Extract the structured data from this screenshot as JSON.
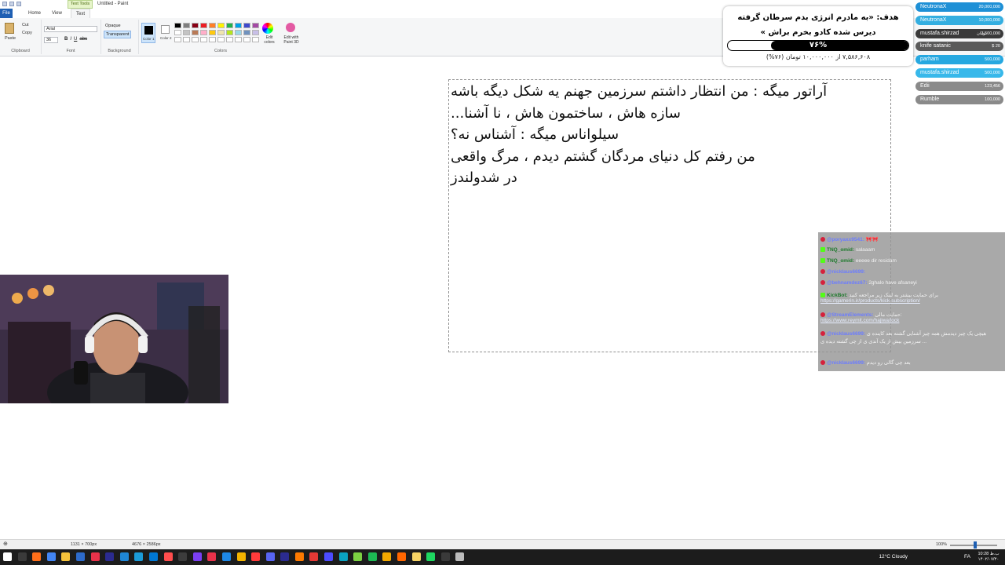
{
  "window": {
    "title": "Untitled - Paint",
    "context_tab": "Text Tools"
  },
  "menu_tabs": [
    "File",
    "Home",
    "View",
    "Text"
  ],
  "ribbon": {
    "clipboard": {
      "paste": "Paste",
      "cut": "Cut",
      "copy": "Copy",
      "label": "Clipboard"
    },
    "font": {
      "family": "Arial",
      "size": "36",
      "bold": "B",
      "italic": "I",
      "underline": "U",
      "strike": "abc",
      "label": "Font"
    },
    "background": {
      "opaque": "Opaque",
      "transparent": "Transparent",
      "label": "Background"
    },
    "color1": "Color 1",
    "color2": "Color 2",
    "colors_label": "Colors",
    "edit_colors": "Edit colors",
    "edit_paint3d": "Edit with Paint 3D",
    "palette": [
      "#000000",
      "#7f7f7f",
      "#880015",
      "#ed1c24",
      "#ff7f27",
      "#fff200",
      "#22b14c",
      "#00a2e8",
      "#3f48cc",
      "#a349a4",
      "#ffffff",
      "#c3c3c3",
      "#b97a57",
      "#ffaec9",
      "#ffc90e",
      "#efe4b0",
      "#b5e61d",
      "#99d9ea",
      "#7092be",
      "#c8bfe7",
      "#ffffff",
      "#ffffff",
      "#ffffff",
      "#ffffff",
      "#ffffff",
      "#ffffff",
      "#ffffff",
      "#ffffff",
      "#ffffff",
      "#ffffff"
    ]
  },
  "canvas_text": {
    "lines": [
      "آراتور میگه : من انتظار داشتم سرزمین جهنم یه شکل دیگه باشه",
      "سازه هاش ، ساختمون هاش ، نا آشنا...",
      "سیلواناس میگه : آشناس نه؟",
      "من رفتم کل دنیای مردگان گشتم دیدم ، مرگ واقعی",
      "در شدولندز"
    ]
  },
  "donation_goal": {
    "title": "هدف: «به مادرم انرژی بدم سرطان گرفته دیرس شده کادو بخرم براش »",
    "percent_label": "۷۶%",
    "progress": 0.76,
    "subtitle": "۷,۵۸۶,۶۰۸ از ۱۰,۰۰۰,۰۰۰ تومان (۷۶%)"
  },
  "leaderboard": [
    {
      "name": "NeutronaX",
      "amount": "20,000,000",
      "color": "#1e90d6"
    },
    {
      "name": "NeutronaX",
      "amount": "10,000,000",
      "color": "#33aee0"
    },
    {
      "name": "mustafa.shirzad",
      "amount": "3,500,000",
      "extra": "تومان",
      "color": "#3a3a3a"
    },
    {
      "name": "knife satanic",
      "amount": "$ 20",
      "color": "#5a5a5a"
    },
    {
      "name": "parham",
      "amount": "500,000",
      "color": "#26a8e0"
    },
    {
      "name": "mustafa.shirzad",
      "amount": "500,000",
      "color": "#38b8ea"
    },
    {
      "name": "Edii",
      "amount": "123,456",
      "color": "#8a8a8a"
    },
    {
      "name": "Rumble",
      "amount": "100,000",
      "color": "#8a8a8a"
    }
  ],
  "chat": [
    {
      "user": "@poryaxx9541:",
      "text": "🎀🎀",
      "badge": "r"
    },
    {
      "user": "TNQ_omid:",
      "text": "salaaam",
      "badge": "g"
    },
    {
      "user": "TNQ_omid:",
      "text": "eeeee dir residam",
      "badge": "g"
    },
    {
      "user": "@nicklaus6699:",
      "text": "",
      "badge": "r"
    },
    {
      "user": "@behnamdez67:",
      "text": "2ghalo have afsaneyi",
      "badge": "r"
    },
    {
      "user": "KickBot:",
      "text": "برای حمایت بیشتر به لینک زیر مراجعه کنید",
      "badge": "g",
      "link": "https://gamerin.ir/products/kick-subscription/"
    },
    {
      "user": "@StreamElements:",
      "text": "حمایت مالی:",
      "badge": "r",
      "link": "https://www.reymit.com/hajiwa/lock"
    },
    {
      "user": "@nicklaus6699:",
      "text": "هیچی یک چیز دیدمش همه چیز آشنایی گشته بعد کاینده ی سرزمین بیش از یک آندی ی از چی گشته دیده ی ...",
      "badge": "r"
    },
    {
      "user": "@nicklaus6699:",
      "text": "بعد چی گالی رو دیدم",
      "badge": "r"
    }
  ],
  "statusbar": {
    "selection_size": "1131 × 700px",
    "image_size": "4676 × 2586px",
    "zoom": "100%"
  },
  "taskbar": {
    "weather": "12°C  Cloudy",
    "language": "FA",
    "time": "10:28 ب.ظ",
    "date": "۱۴۰۲/۰۷/۳۰"
  }
}
